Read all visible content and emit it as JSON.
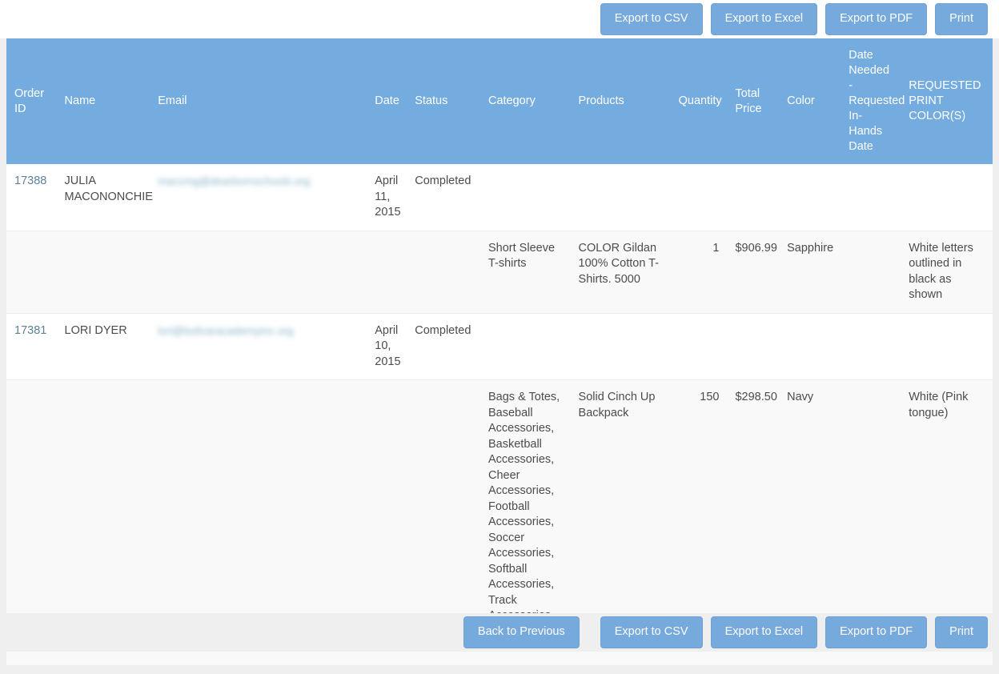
{
  "toolbar_top": {
    "buttons": [
      {
        "label": "Export to CSV",
        "name": "export-csv-button"
      },
      {
        "label": "Export to Excel",
        "name": "export-excel-button"
      },
      {
        "label": "Export to PDF",
        "name": "export-pdf-button"
      },
      {
        "label": "Print",
        "name": "print-button"
      }
    ]
  },
  "table": {
    "headers": {
      "order_id": "Order ID",
      "name": "Name",
      "email": "Email",
      "date": "Date",
      "status": "Status",
      "category": "Category",
      "products": "Products",
      "quantity": "Quantity",
      "total_price": "Total Price",
      "color": "Color",
      "date_needed": "Date Needed - Requested In-Hands Date",
      "requested_print_colors": "REQUESTED PRINT COLOR(S)"
    },
    "rows": [
      {
        "order_id": "17388",
        "name": "JULIA MACONONCHIE",
        "email": "maccmg@dearbornschools.org",
        "email_redacted": true,
        "date": "April 11, 2015",
        "status": "Completed",
        "detail": {
          "category": "Short Sleeve T-shirts",
          "products": "COLOR Gildan 100% Cotton T-Shirts. 5000",
          "quantity": "1",
          "total_price": "$906.99",
          "color": "Sapphire",
          "date_needed": "",
          "requested_print_colors": "White letters outlined in black as shown"
        }
      },
      {
        "order_id": "17381",
        "name": "LORI DYER",
        "email": "lori@bolivaracademyinc.org",
        "email_redacted": true,
        "date": "April 10, 2015",
        "status": "Completed",
        "detail": {
          "category": "Bags & Totes, Baseball Accessories, Basketball Accessories, Cheer Accessories, Football Accessories, Soccer Accessories, Softball Accessories, Track Accessories, Volleyball Accessories",
          "products": "Solid Cinch Up Backpack",
          "quantity": "150",
          "total_price": "$298.50",
          "color": "Navy",
          "date_needed": "",
          "requested_print_colors": "White (Pink tongue)"
        }
      }
    ]
  },
  "toolbar_bottom": {
    "buttons": [
      {
        "label": "Back to Previous",
        "name": "back-to-previous-button"
      },
      {
        "label": "Export to CSV",
        "name": "export-csv-button"
      },
      {
        "label": "Export to Excel",
        "name": "export-excel-button"
      },
      {
        "label": "Export to PDF",
        "name": "export-pdf-button"
      },
      {
        "label": "Print",
        "name": "print-button"
      }
    ]
  },
  "colors": {
    "header_bg": "#74ace0",
    "button_bg": "#76a9dc",
    "link": "#5d8296",
    "status_completed": "#3f8d3f",
    "row_alt_bg": "#f9f9f9",
    "page_bg": "#efefef"
  }
}
